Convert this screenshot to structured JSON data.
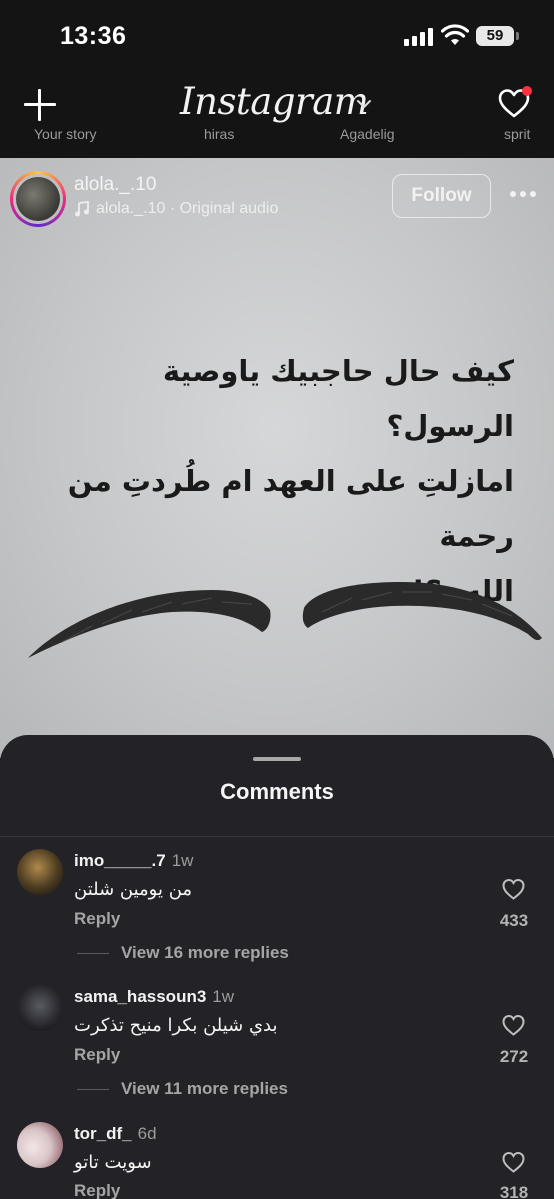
{
  "status_bar": {
    "time": "13:36",
    "battery": "59"
  },
  "top_nav": {
    "logo": "Instagram",
    "stories_peek": [
      "Your story",
      "hiras",
      "Agadelig",
      "sprit"
    ]
  },
  "post": {
    "username": "alola._.10",
    "audio": "alola._.10 · Original audio",
    "follow_label": "Follow",
    "text_lines": [
      "كيف حال حاجبيك ياوصية الرسول؟",
      "امازلتِ على العهد ام طُردتِ من رحمة",
      "الله..؟!"
    ]
  },
  "comments_sheet": {
    "title": "Comments",
    "comments": [
      {
        "user": "imo_____.7",
        "age": "1w",
        "text": "من يومين شلتن",
        "reply_label": "Reply",
        "likes": "433",
        "more_replies": "View 16 more replies"
      },
      {
        "user": "sama_hassoun3",
        "age": "1w",
        "text": "بدي شيلن بكرا منيح تذكرت",
        "reply_label": "Reply",
        "likes": "272",
        "more_replies": "View 11 more replies"
      },
      {
        "user": "tor_df_",
        "age": "6d",
        "text": "سويت تاتو",
        "reply_label": "Reply",
        "likes": "318"
      }
    ]
  },
  "colors": {
    "notification": "#ff3040",
    "sheet_bg": "#232327",
    "post_bg": "#c6c7c8"
  },
  "icons": [
    "plus-icon",
    "instagram-logo",
    "chevron-down-icon",
    "heart-icon",
    "music-note-icon",
    "more-icon"
  ]
}
